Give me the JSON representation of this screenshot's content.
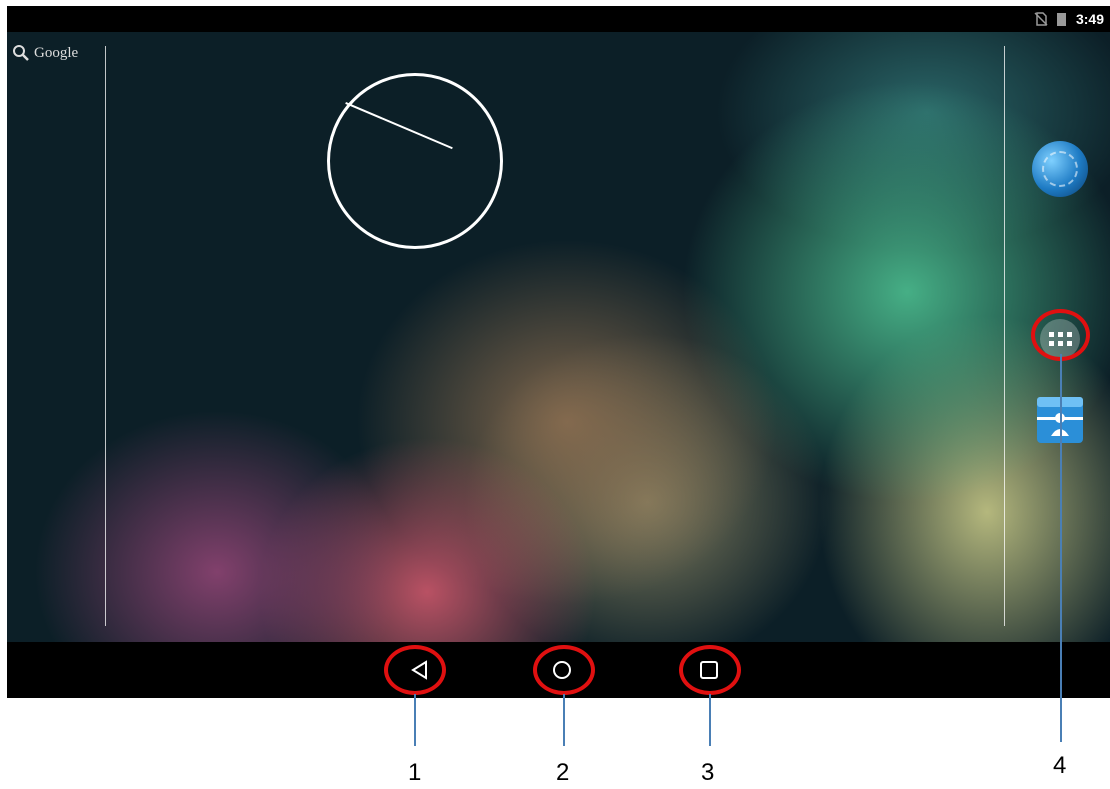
{
  "status_bar": {
    "time": "3:49",
    "icons": [
      "no-sim-icon",
      "battery-icon"
    ]
  },
  "search_widget": {
    "label": "Google",
    "icon": "search-icon"
  },
  "clock_widget": {
    "type": "analog-clock"
  },
  "dock": {
    "items": [
      "browser-icon",
      "all-apps-icon",
      "contacts-icon"
    ]
  },
  "nav_bar": {
    "buttons": [
      "back-icon",
      "home-icon",
      "recent-apps-icon"
    ]
  },
  "annotations": {
    "callouts": [
      "1",
      "2",
      "3",
      "4"
    ],
    "highlight_color": "#e01010",
    "leader_color": "#4a7fb5"
  }
}
